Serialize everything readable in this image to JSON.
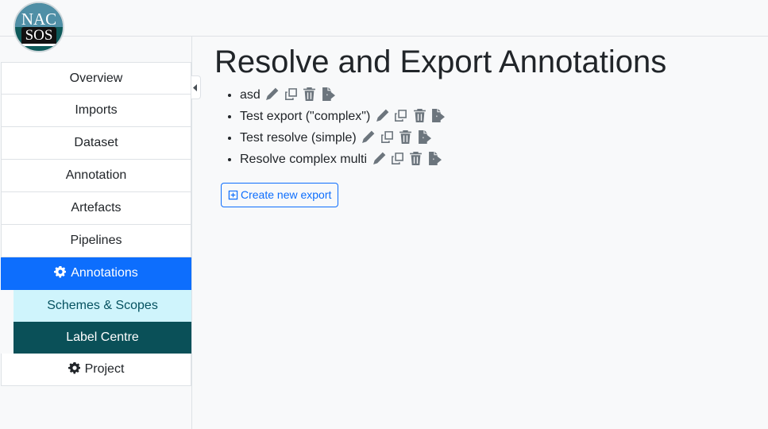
{
  "logo": {
    "top_text": "NAC",
    "bottom_text": "SOS"
  },
  "sidebar": {
    "items": [
      {
        "label": "Overview"
      },
      {
        "label": "Imports"
      },
      {
        "label": "Dataset"
      },
      {
        "label": "Annotation"
      },
      {
        "label": "Artefacts"
      },
      {
        "label": "Pipelines"
      },
      {
        "label": "Annotations"
      },
      {
        "label": "Schemes & Scopes"
      },
      {
        "label": "Label Centre"
      },
      {
        "label": "Project"
      }
    ]
  },
  "main": {
    "title": "Resolve and Export Annotations",
    "exports": [
      {
        "name": "asd"
      },
      {
        "name": "Test export (\"complex\")"
      },
      {
        "name": "Test resolve (simple)"
      },
      {
        "name": "Resolve complex multi"
      }
    ],
    "create_label": "Create new export"
  },
  "colors": {
    "primary": "#0d6efd",
    "info_light": "#cff4fc",
    "teal_dark": "#0a5058"
  },
  "icons": [
    "pencil-icon",
    "copy-icon",
    "trash-icon",
    "file-export-icon",
    "gear-icon",
    "plus-square-icon",
    "chevron-left-icon"
  ]
}
